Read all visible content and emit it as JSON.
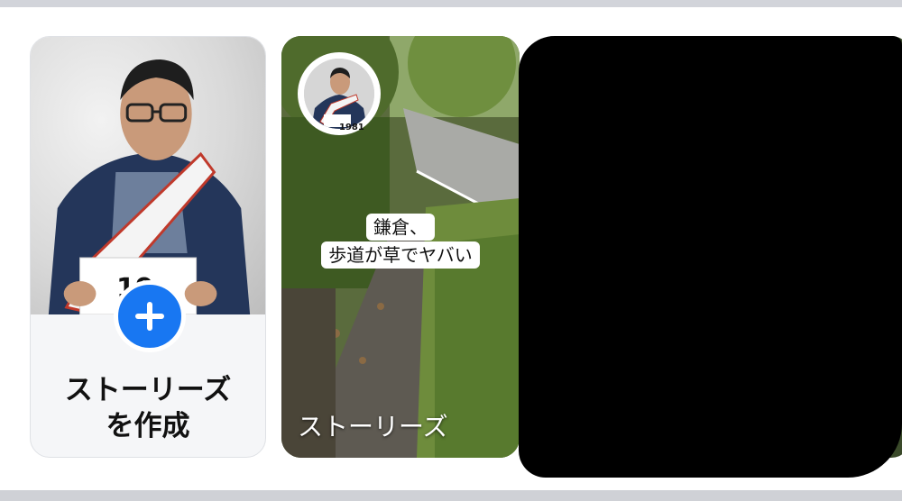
{
  "create_card": {
    "label_line1": "ストーリーズ",
    "label_line2": "を作成",
    "plus_icon": "plus-icon",
    "badge_number": "19"
  },
  "story_card": {
    "caption_line1": "鎌倉、",
    "caption_line2": "歩道が草でヤバい",
    "title": "ストーリーズ",
    "avatar_badge_number": "1981"
  },
  "colors": {
    "accent_blue": "#1877f2",
    "card_bg": "#f5f6f8",
    "divider": "#d2d4da"
  }
}
